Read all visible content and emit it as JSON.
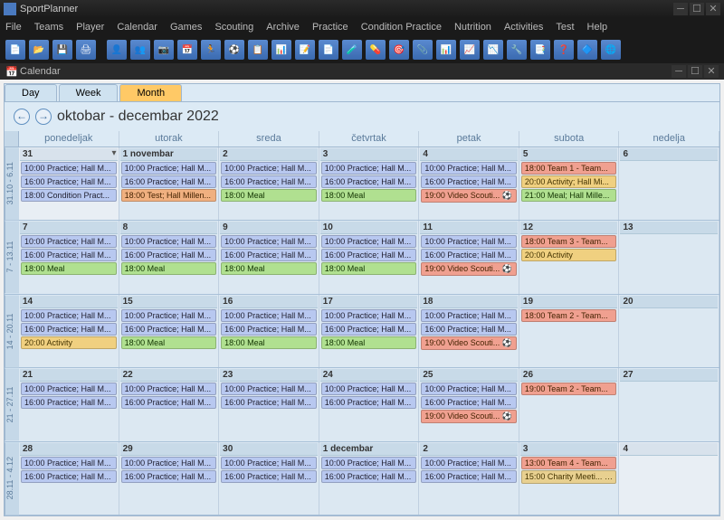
{
  "app": {
    "title": "SportPlanner"
  },
  "menubar": [
    "File",
    "Teams",
    "Player",
    "Calendar",
    "Games",
    "Scouting",
    "Archive",
    "Practice",
    "Condition Practice",
    "Nutrition",
    "Activities",
    "Test",
    "Help"
  ],
  "subwindow": {
    "title": "Calendar"
  },
  "viewTabs": {
    "day": "Day",
    "week": "Week",
    "month": "Month"
  },
  "nav": {
    "title": "oktobar - decembar 2022"
  },
  "dayHeaders": [
    "ponedeljak",
    "utorak",
    "sreda",
    "četvrtak",
    "petak",
    "subota",
    "nedelja"
  ],
  "weeks": [
    {
      "label": "31.10 - 6.11",
      "days": [
        {
          "num": "31",
          "other": true,
          "events": [
            {
              "t": "10:00",
              "txt": "Practice; Hall M...",
              "c": "practice"
            },
            {
              "t": "16:00",
              "txt": "Practice; Hall M...",
              "c": "practice"
            },
            {
              "t": "18:00",
              "txt": "Condition Pract...",
              "c": "practice"
            }
          ],
          "more": true
        },
        {
          "num": "1 novembar",
          "events": [
            {
              "t": "10:00",
              "txt": "Practice; Hall M...",
              "c": "practice"
            },
            {
              "t": "16:00",
              "txt": "Practice; Hall M...",
              "c": "practice"
            },
            {
              "t": "18:00",
              "txt": "Test; Hall Millen...",
              "c": "test"
            }
          ]
        },
        {
          "num": "2",
          "events": [
            {
              "t": "10:00",
              "txt": "Practice; Hall M...",
              "c": "practice"
            },
            {
              "t": "16:00",
              "txt": "Practice; Hall M...",
              "c": "practice"
            },
            {
              "t": "18:00",
              "txt": "Meal",
              "c": "meal"
            }
          ]
        },
        {
          "num": "3",
          "events": [
            {
              "t": "10:00",
              "txt": "Practice; Hall M...",
              "c": "practice"
            },
            {
              "t": "16:00",
              "txt": "Practice; Hall M...",
              "c": "practice"
            },
            {
              "t": "18:00",
              "txt": "Meal",
              "c": "meal"
            }
          ]
        },
        {
          "num": "4",
          "events": [
            {
              "t": "10:00",
              "txt": "Practice; Hall M...",
              "c": "practice"
            },
            {
              "t": "16:00",
              "txt": "Practice; Hall M...",
              "c": "practice"
            },
            {
              "t": "19:00",
              "txt": "Video Scouti... ⚽",
              "c": "video"
            }
          ]
        },
        {
          "num": "5",
          "events": [
            {
              "t": "18:00",
              "txt": "Team 1 - Team...",
              "c": "team"
            },
            {
              "t": "20:00",
              "txt": "Activity; Hall Mi...",
              "c": "activity"
            },
            {
              "t": "21:00",
              "txt": "Meal; Hall Mille...",
              "c": "meal"
            }
          ]
        },
        {
          "num": "6",
          "events": []
        }
      ]
    },
    {
      "label": "7 - 13.11",
      "days": [
        {
          "num": "7",
          "events": [
            {
              "t": "10:00",
              "txt": "Practice; Hall M...",
              "c": "practice"
            },
            {
              "t": "16:00",
              "txt": "Practice; Hall M...",
              "c": "practice"
            },
            {
              "t": "18:00",
              "txt": "Meal",
              "c": "meal"
            }
          ]
        },
        {
          "num": "8",
          "events": [
            {
              "t": "10:00",
              "txt": "Practice; Hall M...",
              "c": "practice"
            },
            {
              "t": "16:00",
              "txt": "Practice; Hall M...",
              "c": "practice"
            },
            {
              "t": "18:00",
              "txt": "Meal",
              "c": "meal"
            }
          ]
        },
        {
          "num": "9",
          "events": [
            {
              "t": "10:00",
              "txt": "Practice; Hall M...",
              "c": "practice"
            },
            {
              "t": "16:00",
              "txt": "Practice; Hall M...",
              "c": "practice"
            },
            {
              "t": "18:00",
              "txt": "Meal",
              "c": "meal"
            }
          ]
        },
        {
          "num": "10",
          "events": [
            {
              "t": "10:00",
              "txt": "Practice; Hall M...",
              "c": "practice"
            },
            {
              "t": "16:00",
              "txt": "Practice; Hall M...",
              "c": "practice"
            },
            {
              "t": "18:00",
              "txt": "Meal",
              "c": "meal"
            }
          ]
        },
        {
          "num": "11",
          "events": [
            {
              "t": "10:00",
              "txt": "Practice; Hall M...",
              "c": "practice"
            },
            {
              "t": "16:00",
              "txt": "Practice; Hall M...",
              "c": "practice"
            },
            {
              "t": "19:00",
              "txt": "Video Scouti... ⚽",
              "c": "video"
            }
          ]
        },
        {
          "num": "12",
          "events": [
            {
              "t": "18:00",
              "txt": "Team 3 - Team...",
              "c": "team"
            },
            {
              "t": "20:00",
              "txt": "Activity",
              "c": "activity"
            }
          ]
        },
        {
          "num": "13",
          "events": []
        }
      ]
    },
    {
      "label": "14 - 20.11",
      "days": [
        {
          "num": "14",
          "events": [
            {
              "t": "10:00",
              "txt": "Practice; Hall M...",
              "c": "practice"
            },
            {
              "t": "16:00",
              "txt": "Practice; Hall M...",
              "c": "practice"
            },
            {
              "t": "20:00",
              "txt": "Activity",
              "c": "activity"
            }
          ]
        },
        {
          "num": "15",
          "events": [
            {
              "t": "10:00",
              "txt": "Practice; Hall M...",
              "c": "practice"
            },
            {
              "t": "16:00",
              "txt": "Practice; Hall M...",
              "c": "practice"
            },
            {
              "t": "18:00",
              "txt": "Meal",
              "c": "meal"
            }
          ]
        },
        {
          "num": "16",
          "events": [
            {
              "t": "10:00",
              "txt": "Practice; Hall M...",
              "c": "practice"
            },
            {
              "t": "16:00",
              "txt": "Practice; Hall M...",
              "c": "practice"
            },
            {
              "t": "18:00",
              "txt": "Meal",
              "c": "meal"
            }
          ]
        },
        {
          "num": "17",
          "events": [
            {
              "t": "10:00",
              "txt": "Practice; Hall M...",
              "c": "practice"
            },
            {
              "t": "16:00",
              "txt": "Practice; Hall M...",
              "c": "practice"
            },
            {
              "t": "18:00",
              "txt": "Meal",
              "c": "meal"
            }
          ]
        },
        {
          "num": "18",
          "events": [
            {
              "t": "10:00",
              "txt": "Practice; Hall M...",
              "c": "practice"
            },
            {
              "t": "16:00",
              "txt": "Practice; Hall M...",
              "c": "practice"
            },
            {
              "t": "19:00",
              "txt": "Video Scouti... ⚽",
              "c": "video"
            }
          ]
        },
        {
          "num": "19",
          "events": [
            {
              "t": "18:00",
              "txt": "Team 2 - Team...",
              "c": "team"
            }
          ]
        },
        {
          "num": "20",
          "events": []
        }
      ]
    },
    {
      "label": "21 - 27.11",
      "days": [
        {
          "num": "21",
          "events": [
            {
              "t": "10:00",
              "txt": "Practice; Hall M...",
              "c": "practice"
            },
            {
              "t": "16:00",
              "txt": "Practice; Hall M...",
              "c": "practice"
            }
          ]
        },
        {
          "num": "22",
          "events": [
            {
              "t": "10:00",
              "txt": "Practice; Hall M...",
              "c": "practice"
            },
            {
              "t": "16:00",
              "txt": "Practice; Hall M...",
              "c": "practice"
            }
          ]
        },
        {
          "num": "23",
          "events": [
            {
              "t": "10:00",
              "txt": "Practice; Hall M...",
              "c": "practice"
            },
            {
              "t": "16:00",
              "txt": "Practice; Hall M...",
              "c": "practice"
            }
          ]
        },
        {
          "num": "24",
          "events": [
            {
              "t": "10:00",
              "txt": "Practice; Hall M...",
              "c": "practice"
            },
            {
              "t": "16:00",
              "txt": "Practice; Hall M...",
              "c": "practice"
            }
          ]
        },
        {
          "num": "25",
          "events": [
            {
              "t": "10:00",
              "txt": "Practice; Hall M...",
              "c": "practice"
            },
            {
              "t": "16:00",
              "txt": "Practice; Hall M...",
              "c": "practice"
            },
            {
              "t": "19:00",
              "txt": "Video Scouti... ⚽",
              "c": "video"
            }
          ]
        },
        {
          "num": "26",
          "events": [
            {
              "t": "19:00",
              "txt": "Team 2 - Team...",
              "c": "team"
            }
          ]
        },
        {
          "num": "27",
          "events": []
        }
      ]
    },
    {
      "label": "28.11 - 4.12",
      "days": [
        {
          "num": "28",
          "events": [
            {
              "t": "10:00",
              "txt": "Practice; Hall M...",
              "c": "practice"
            },
            {
              "t": "16:00",
              "txt": "Practice; Hall M...",
              "c": "practice"
            }
          ]
        },
        {
          "num": "29",
          "events": [
            {
              "t": "10:00",
              "txt": "Practice; Hall M...",
              "c": "practice"
            },
            {
              "t": "16:00",
              "txt": "Practice; Hall M...",
              "c": "practice"
            }
          ]
        },
        {
          "num": "30",
          "events": [
            {
              "t": "10:00",
              "txt": "Practice; Hall M...",
              "c": "practice"
            },
            {
              "t": "16:00",
              "txt": "Practice; Hall M...",
              "c": "practice"
            }
          ]
        },
        {
          "num": "1 decembar",
          "events": [
            {
              "t": "10:00",
              "txt": "Practice; Hall M...",
              "c": "practice"
            },
            {
              "t": "16:00",
              "txt": "Practice; Hall M...",
              "c": "practice"
            }
          ]
        },
        {
          "num": "2",
          "events": [
            {
              "t": "10:00",
              "txt": "Practice; Hall M...",
              "c": "practice"
            },
            {
              "t": "16:00",
              "txt": "Practice; Hall M...",
              "c": "practice"
            }
          ]
        },
        {
          "num": "3",
          "events": [
            {
              "t": "13:00",
              "txt": "Team 4 - Team...",
              "c": "team"
            },
            {
              "t": "15:00",
              "txt": "Charity Meeti... ⚽",
              "c": "meeting"
            }
          ]
        },
        {
          "num": "4",
          "other": true,
          "events": []
        }
      ]
    }
  ]
}
